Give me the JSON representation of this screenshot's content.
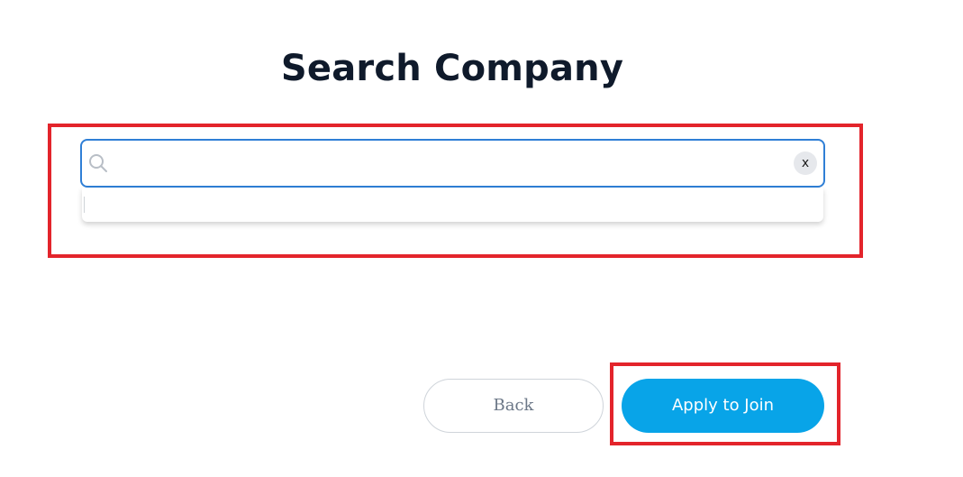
{
  "page": {
    "title": "Search Company"
  },
  "search": {
    "value": "",
    "placeholder": "",
    "clear_label": "x",
    "icon": "search-icon"
  },
  "dropdown": {
    "items": [
      ""
    ]
  },
  "actions": {
    "back_label": "Back",
    "apply_label": "Apply to Join"
  },
  "colors": {
    "title": "#0f1a2b",
    "accent": "#08a4e8",
    "focus_border": "#2f7fd6",
    "highlight": "#e3242b"
  }
}
